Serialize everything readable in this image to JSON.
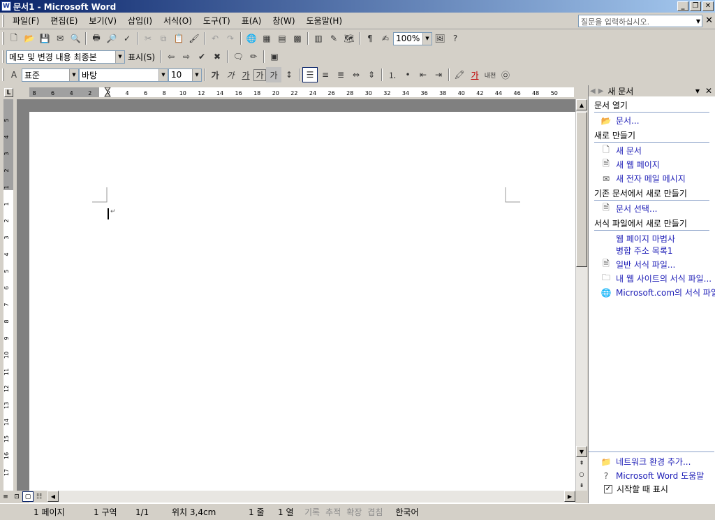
{
  "window": {
    "title": "문서1 - Microsoft Word",
    "icon_letter": "W"
  },
  "menu": {
    "items": [
      "파일(F)",
      "편집(E)",
      "보기(V)",
      "삽입(I)",
      "서식(O)",
      "도구(T)",
      "표(A)",
      "창(W)",
      "도움말(H)"
    ],
    "help_placeholder": "질문을 입력하십시오."
  },
  "standard_toolbar": {
    "zoom": "100%"
  },
  "review_toolbar": {
    "view_mode": "메모 및 변경 내용 최종본",
    "show_label": "표시(S)"
  },
  "format_toolbar": {
    "style": "표준",
    "font": "바탕",
    "size": "10",
    "bold": "가",
    "italic": "가",
    "underline": "가",
    "border": "가",
    "shade": "가",
    "font_color": "가",
    "phonetic": "내천"
  },
  "ruler": {
    "h_ticks": [
      "8",
      "6",
      "4",
      "2",
      "2",
      "4",
      "6",
      "8",
      "10",
      "12",
      "14",
      "16",
      "18",
      "20",
      "22",
      "24",
      "26",
      "28",
      "30",
      "32",
      "34",
      "36",
      "38",
      "40",
      "42",
      "44",
      "46",
      "48",
      "50"
    ],
    "v_ticks": [
      "5",
      "4",
      "3",
      "2",
      "1",
      "1",
      "2",
      "3",
      "4",
      "5",
      "6",
      "7",
      "8",
      "9",
      "10",
      "11",
      "12",
      "13",
      "14",
      "15",
      "16",
      "17"
    ]
  },
  "task_pane": {
    "title": "새 문서",
    "sections": [
      {
        "title": "문서 열기",
        "links": [
          {
            "icon": "folder-icon",
            "label": "문서..."
          }
        ]
      },
      {
        "title": "새로 만들기",
        "links": [
          {
            "icon": "blank-document-icon",
            "label": "새 문서"
          },
          {
            "icon": "web-page-icon",
            "label": "새 웹 페이지"
          },
          {
            "icon": "email-icon",
            "label": "새 전자 메일 메시지"
          }
        ]
      },
      {
        "title": "기존 문서에서 새로 만들기",
        "links": [
          {
            "icon": "document-icon",
            "label": "문서 선택..."
          }
        ]
      },
      {
        "title": "서식 파일에서 새로 만들기",
        "links": [
          {
            "icon": "",
            "label": "웹 페이지 마법사"
          },
          {
            "icon": "",
            "label": "병합 주소 목록1"
          },
          {
            "icon": "template-icon",
            "label": "일반 서식 파일..."
          },
          {
            "icon": "website-template-icon",
            "label": "내 웹 사이트의 서식 파일..."
          },
          {
            "icon": "globe-icon",
            "label": "Microsoft.com의 서식 파일"
          }
        ]
      }
    ],
    "bottom_links": [
      {
        "icon": "network-folder-icon",
        "label": "네트워크 환경 추가..."
      },
      {
        "icon": "help-icon",
        "label": "Microsoft Word 도움말"
      }
    ],
    "show_at_startup": "시작할 때 표시"
  },
  "status": {
    "page": "1 페이지",
    "section": "1 구역",
    "pages": "1/1",
    "position": "위치 3,4cm",
    "line": "1 줄",
    "column": "1 열",
    "rec": "기록",
    "trk": "추적",
    "ext": "확장",
    "ovr": "겹침",
    "language": "한국어"
  }
}
